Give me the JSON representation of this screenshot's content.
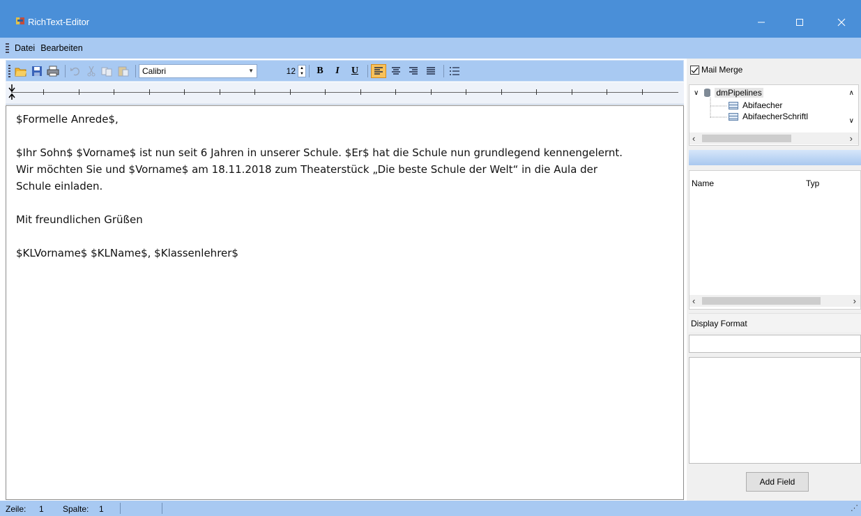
{
  "window": {
    "title": "RichText-Editor",
    "colors": {
      "titlebar": "#4a8fd8",
      "chrome": "#a8c9f2",
      "active_button": "#f8c15a"
    }
  },
  "menu": {
    "items": [
      "Datei",
      "Bearbeiten"
    ]
  },
  "toolbar": {
    "icons": [
      "open-folder-icon",
      "save-icon",
      "print-icon",
      "undo-icon",
      "cut-icon",
      "copy-icon",
      "paste-icon"
    ],
    "font_name": "Calibri",
    "font_size": "12",
    "bold_label": "B",
    "italic_label": "I",
    "underline_label": "U",
    "alignment_selected": "left"
  },
  "document": {
    "lines": [
      "$Formelle Anrede$,",
      "",
      "$Ihr Sohn$ $Vorname$ ist nun seit 6 Jahren in unserer Schule. $Er$ hat die Schule nun grundlegend kennengelernt.",
      "Wir möchten Sie und $Vorname$ am 18.11.2018 zum Theaterstück „Die beste Schule der Welt“ in die Aula der",
      "Schule einladen.",
      "",
      "Mit freundlichen Grüßen",
      "",
      "$KLVorname$ $KLName$, $Klassenlehrer$"
    ]
  },
  "mailmerge": {
    "label": "Mail Merge",
    "checked": true,
    "tree": {
      "root": "dmPipelines",
      "children": [
        "Abifaecher",
        "AbifaecherSchriftl"
      ]
    },
    "columns": {
      "name": "Name",
      "type": "Typ"
    },
    "display_format_label": "Display Format",
    "display_format_value": "",
    "add_field_label": "Add Field"
  },
  "status": {
    "row_label": "Zeile:",
    "row_value": "1",
    "col_label": "Spalte:",
    "col_value": "1"
  }
}
